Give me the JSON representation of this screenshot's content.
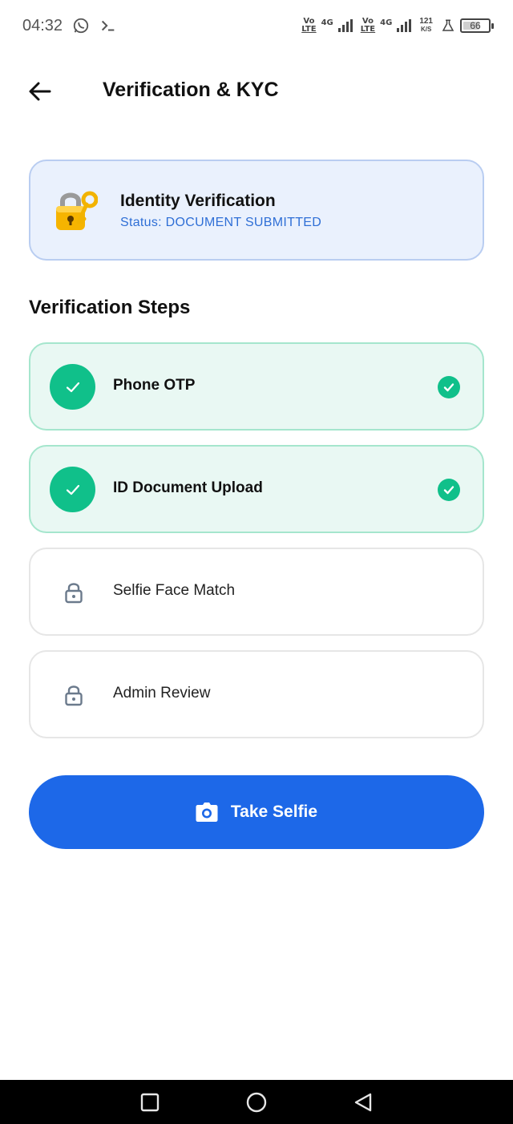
{
  "status_bar": {
    "time": "04:32",
    "net1_top": "Vo",
    "net1_bottom": "LTE",
    "net1_gen": "4G",
    "net2_top": "Vo",
    "net2_bottom": "LTE",
    "net2_gen": "4G",
    "speed_value": "121",
    "speed_unit": "K/S",
    "battery": "66"
  },
  "header": {
    "title": "Verification & KYC",
    "back_icon": "arrow-left-icon"
  },
  "identity_card": {
    "title": "Identity Verification",
    "status": "Status: DOCUMENT SUBMITTED",
    "icon": "locked-with-key-icon"
  },
  "steps_section": {
    "title": "Verification Steps",
    "steps": [
      {
        "label": "Phone OTP",
        "state": "completed"
      },
      {
        "label": "ID Document Upload",
        "state": "completed"
      },
      {
        "label": "Selfie Face Match",
        "state": "locked"
      },
      {
        "label": "Admin Review",
        "state": "locked"
      }
    ]
  },
  "primary_action": {
    "label": "Take Selfie",
    "icon": "camera-icon"
  },
  "colors": {
    "accent": "#1d68e8",
    "success": "#10c08a",
    "status_blue": "#2f6fd6"
  }
}
